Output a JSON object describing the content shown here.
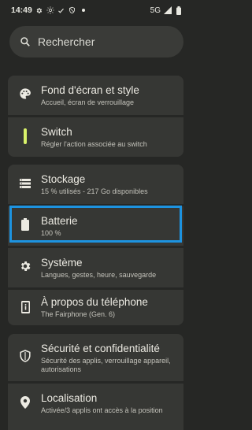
{
  "status_bar": {
    "time": "14:49",
    "network": "5G",
    "icons": [
      "gear-icon",
      "sun-icon",
      "check-icon",
      "shield-icon",
      "dot-icon",
      "signal-icon",
      "battery-icon"
    ]
  },
  "search": {
    "placeholder": "Rechercher"
  },
  "settings": {
    "items": [
      {
        "title": "Fond d'écran et style",
        "subtitle": "Accueil, écran de verrouillage",
        "icon": "palette-icon"
      },
      {
        "title": "Switch",
        "subtitle": "Régler l'action associée au switch",
        "icon": "switch-icon"
      },
      {
        "title": "Stockage",
        "subtitle": "15 % utilisés - 217 Go disponibles",
        "icon": "storage-icon"
      },
      {
        "title": "Batterie",
        "subtitle": "100 %",
        "icon": "battery-icon"
      },
      {
        "title": "Système",
        "subtitle": "Langues, gestes, heure, sauvegarde",
        "icon": "gear-icon"
      },
      {
        "title": "À propos du téléphone",
        "subtitle": "The Fairphone (Gen. 6)",
        "icon": "phone-info-icon"
      },
      {
        "title": "Sécurité et confidentialité",
        "subtitle_line1": "Sécurité des applis, verrouillage appareil,",
        "subtitle_line2": "autorisations",
        "icon": "shield-icon"
      },
      {
        "title": "Localisation",
        "subtitle": "Activée/3 applis ont accès à la position",
        "icon": "location-pin-icon"
      }
    ]
  },
  "colors": {
    "background": "#262725",
    "card": "#363734",
    "search_bg": "#3a3b38",
    "accent_switch": "#d9f26a",
    "highlight_border": "#1d93e0",
    "title_text": "#eceae2",
    "subtitle_text": "#c4c3bb"
  }
}
